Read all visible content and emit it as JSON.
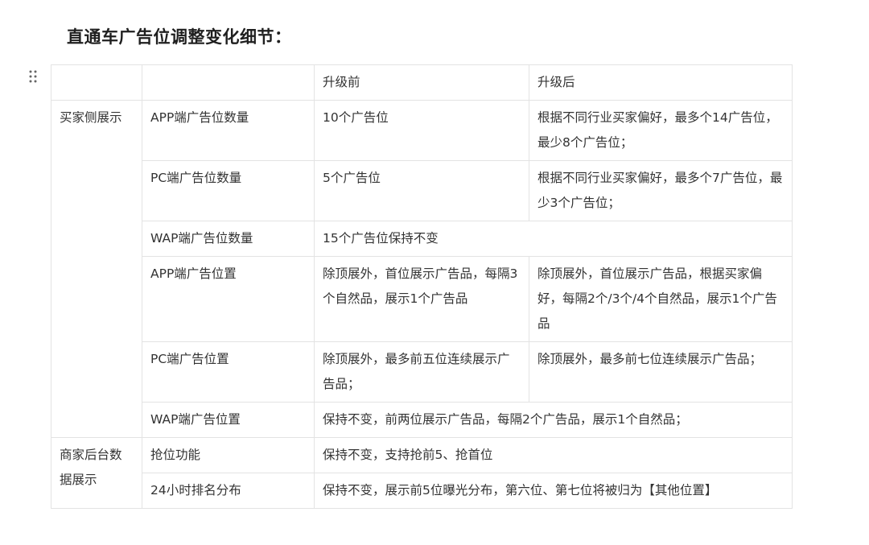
{
  "title": "直通车广告位调整变化细节：",
  "table": {
    "header": {
      "corner_a": "",
      "corner_b": "",
      "before": "升级前",
      "after": "升级后"
    },
    "groups": {
      "buyer_side": "买家侧展示",
      "merchant_backend": "商家后台数据展示"
    },
    "rows": {
      "app_count": {
        "label": "APP端广告位数量",
        "before": "10个广告位",
        "after": "根据不同行业买家偏好，最多个14广告位，最少8个广告位；"
      },
      "pc_count": {
        "label": "PC端广告位数量",
        "before": "5个广告位",
        "after": "根据不同行业买家偏好，最多个7广告位，最少3个广告位；"
      },
      "wap_count": {
        "label": "WAP端广告位数量",
        "merged": "15个广告位保持不变"
      },
      "app_position": {
        "label": "APP端广告位置",
        "before": "除顶展外，首位展示广告品，每隔3个自然品，展示1个广告品",
        "after": "除顶展外，首位展示广告品，根据买家偏好，每隔2个/3个/4个自然品，展示1个广告品"
      },
      "pc_position": {
        "label": "PC端广告位置",
        "before": "除顶展外，最多前五位连续展示广告品；",
        "after": "除顶展外，最多前七位连续展示广告品；"
      },
      "wap_position": {
        "label": "WAP端广告位置",
        "merged": "保持不变，前两位展示广告品，每隔2个广告品，展示1个自然品；"
      },
      "grab_position": {
        "label": "抢位功能",
        "merged": "保持不变，支持抢前5、抢首位"
      },
      "ranking_24h": {
        "label": "24小时排名分布",
        "merged": "保持不变，展示前5位曝光分布，第六位、第七位将被归为【其他位置】"
      }
    }
  },
  "icons": {
    "drag_handle": "drag-handle-icon"
  }
}
